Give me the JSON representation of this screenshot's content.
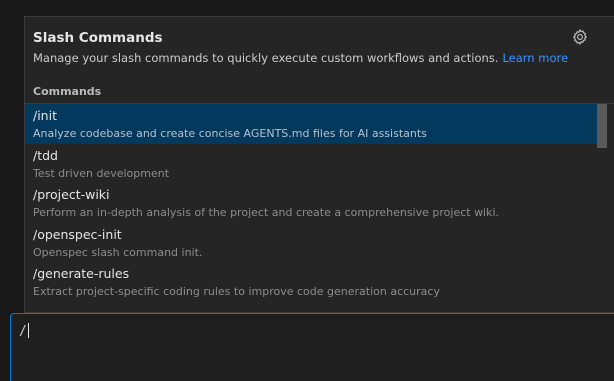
{
  "popup": {
    "title": "Slash Commands",
    "description": "Manage your slash commands to quickly execute custom workflows and actions.",
    "learn_more": "Learn more",
    "settings_icon": "gear-icon",
    "section_label": "Commands"
  },
  "commands": [
    {
      "name": "/init",
      "description": "Analyze codebase and create concise AGENTS.md files for AI assistants",
      "selected": true
    },
    {
      "name": "/tdd",
      "description": "Test driven development",
      "selected": false
    },
    {
      "name": "/project-wiki",
      "description": "Perform an in-depth analysis of the project and create a comprehensive project wiki.",
      "selected": false
    },
    {
      "name": "/openspec-init",
      "description": "Openspec slash command init.",
      "selected": false
    },
    {
      "name": "/generate-rules",
      "description": "Extract project-specific coding rules to improve code generation accuracy",
      "selected": false
    }
  ],
  "input": {
    "value": "/"
  },
  "colors": {
    "selected_bg": "#04395e",
    "link": "#3794ff",
    "focus_border": "#0078d4"
  }
}
